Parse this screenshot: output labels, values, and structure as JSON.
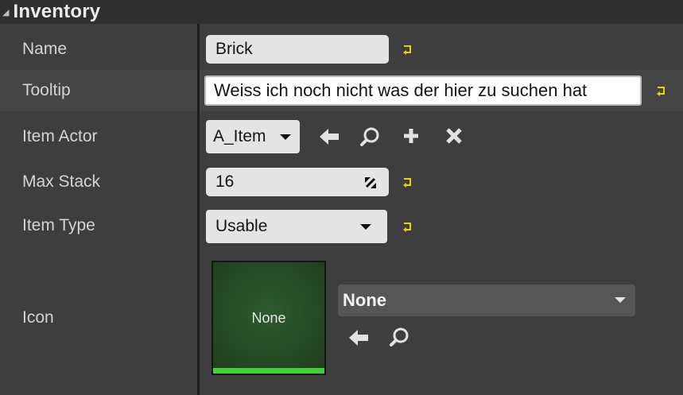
{
  "section": {
    "title": "Inventory"
  },
  "properties": {
    "name": {
      "label": "Name",
      "value": "Brick"
    },
    "tooltip": {
      "label": "Tooltip",
      "value": "Weiss ich noch nicht was der hier zu suchen hat"
    },
    "item_actor": {
      "label": "Item Actor",
      "value": "A_Item"
    },
    "max_stack": {
      "label": "Max Stack",
      "value": "16"
    },
    "item_type": {
      "label": "Item Type",
      "value": "Usable"
    },
    "icon": {
      "label": "Icon",
      "thumbnail_text": "None",
      "combo_value": "None"
    }
  },
  "colors": {
    "panel_bg": "#3e3e3e",
    "header_bg": "#2f2f2f",
    "reset_arrow": "#e6d600",
    "thumb_bar": "#3ed13a",
    "thumb_bg": "#2a4d29"
  },
  "icons": {
    "reset": "reset-arrow-icon",
    "use_selected": "left-arrow-icon",
    "browse": "magnifier-icon",
    "add": "plus-icon",
    "clear": "x-icon",
    "spin": "resize-arrows-icon",
    "dropdown": "caret-down-icon"
  }
}
